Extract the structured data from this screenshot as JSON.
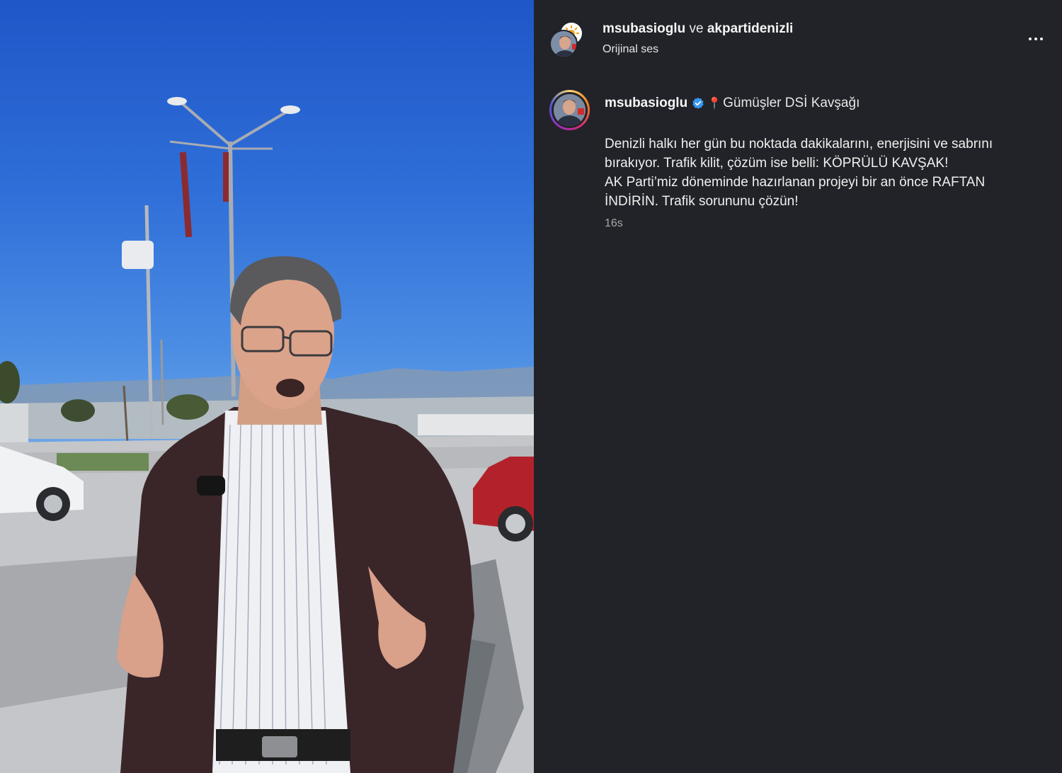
{
  "header": {
    "user1": "msubasioglu",
    "conjunction": "ve",
    "user2": "akpartidenizli",
    "audio": "Orijinal ses",
    "more_icon": "more-horizontal-icon"
  },
  "post": {
    "username": "msubasioglu",
    "location_pin": "📍",
    "location": "Gümüşler DSİ Kavşağı",
    "caption_lines": [
      "Denizli halkı her gün bu noktada dakikalarını, enerjisini ve sabrını",
      "bırakıyor. Trafik kilit, çözüm ise belli: KÖPRÜLÜ KAVŞAK!",
      "AK Parti’miz döneminde hazırlanan projeyi bir an önce RAFTAN",
      "İNDİRİN. Trafik sorununu çözün!"
    ],
    "time": "16s"
  },
  "colors": {
    "panel_bg": "#212328",
    "verified_blue": "#3797f0",
    "text_secondary": "#a8a8a8"
  }
}
